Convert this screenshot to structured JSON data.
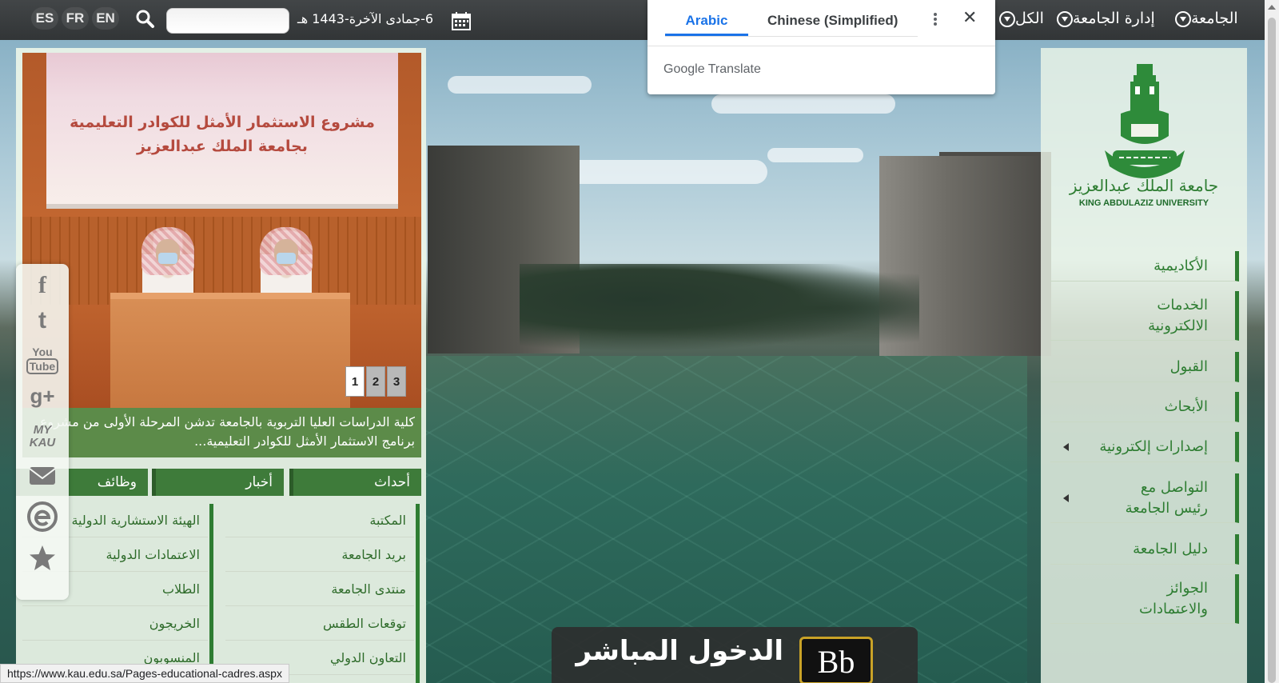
{
  "topbar": {
    "languages": [
      "ES",
      "FR",
      "EN"
    ],
    "date": "6-جمادى الآخرة-1443 هـ",
    "menu": [
      "الجامعة",
      "إدارة الجامعة",
      "الكل"
    ]
  },
  "translate_popup": {
    "tab_active": "Arabic",
    "tab_other": "Chinese (Simplified)",
    "brand_google": "Google",
    "brand_translate": "Translate"
  },
  "logo": {
    "arabic": "جامعة الملك عبدالعزيز",
    "english": "KING ABDULAZIZ UNIVERSITY"
  },
  "nav": {
    "items": [
      {
        "label": "الأكاديمية"
      },
      {
        "label": "الخدمات الالكترونية"
      },
      {
        "label": "القبول"
      },
      {
        "label": "الأبحاث"
      },
      {
        "label": "إصدارات إلكترونية"
      },
      {
        "label": "التواصل مع رئيس الجامعة"
      },
      {
        "label": "دليل الجامعة"
      },
      {
        "label": "الجوائز والاعتمادات"
      }
    ]
  },
  "slider": {
    "screen_line1": "مشروع الاستثمار الأمثل للكوادر التعليمية",
    "screen_line2": "بجامعة الملك عبدالعزيز",
    "pages": [
      "1",
      "2",
      "3"
    ],
    "caption": "كلية الدراسات العليا التربوية بالجامعة تدشن المرحلة الأولى من مشروع برنامج الاستثمار الأمثل للكوادر التعليمية..."
  },
  "tabs": {
    "events": "أحداث",
    "news": "أخبار",
    "jobs": "وظائف"
  },
  "links_col1": [
    "المكتبة",
    "بريد الجامعة",
    "منتدى الجامعة",
    "توقعات الطقس",
    "التعاون الدولي"
  ],
  "links_col2": [
    "الهيئة الاستشارية الدولية",
    "الاعتمادات الدولية",
    "الطلاب",
    "الخريجون",
    "المنسوبون"
  ],
  "social": {
    "facebook": "f",
    "twitter": "t",
    "youtube_top": "You",
    "youtube_bottom": "Tube",
    "googleplus": "g+",
    "mykau_top": "MY",
    "mykau_bottom": "KAU"
  },
  "banner": {
    "text": "الدخول المباشر",
    "logo": "Bb"
  },
  "status_url": "https://www.kau.edu.sa/Pages-educational-cadres.aspx"
}
